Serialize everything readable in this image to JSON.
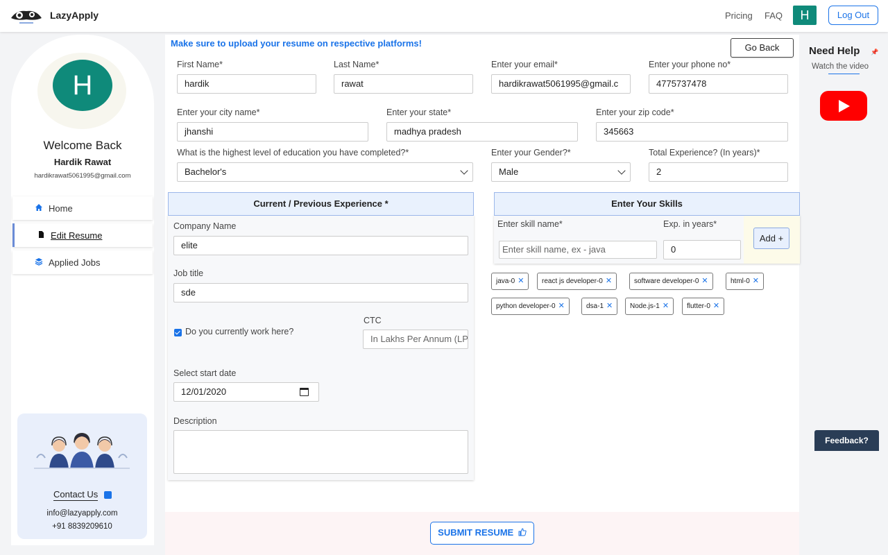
{
  "nav": {
    "brand": "LazyApply",
    "pricing": "Pricing",
    "faq": "FAQ",
    "avatar_initial": "H",
    "logout": "Log Out"
  },
  "sidebar": {
    "avatar_initial": "H",
    "welcome": "Welcome Back",
    "name": "Hardik Rawat",
    "email": "hardikrawat5061995@gmail.com",
    "items": [
      {
        "label": "Home",
        "icon": "home-icon"
      },
      {
        "label": "Edit Resume",
        "icon": "file-icon",
        "active": true
      },
      {
        "label": "Applied Jobs",
        "icon": "layers-icon"
      }
    ],
    "contact": {
      "title": "Contact Us",
      "email": "info@lazyapply.com",
      "phone": "+91 8839209610"
    }
  },
  "form": {
    "notice": "Make sure to upload your resume on respective platforms!",
    "go_back": "Go Back",
    "first_name": {
      "label": "First Name*",
      "value": "hardik"
    },
    "last_name": {
      "label": "Last Name*",
      "value": "rawat"
    },
    "email": {
      "label": "Enter your email*",
      "value": "hardikrawat5061995@gmail.c"
    },
    "phone": {
      "label": "Enter your phone no*",
      "value": "4775737478"
    },
    "city": {
      "label": "Enter your city name*",
      "value": "jhanshi"
    },
    "state": {
      "label": "Enter your state*",
      "value": "madhya pradesh"
    },
    "zip": {
      "label": "Enter your zip code*",
      "value": "345663"
    },
    "education": {
      "label": "What is the highest level of education you have completed?*",
      "value": "Bachelor's"
    },
    "gender": {
      "label": "Enter your Gender?*",
      "value": "Male"
    },
    "experience": {
      "label": "Total Experience? (In years)*",
      "value": "2"
    }
  },
  "experience_section": {
    "title": "Current / Previous Experience *",
    "company": {
      "label": "Company Name",
      "value": "elite"
    },
    "job_title": {
      "label": "Job title",
      "value": "sde"
    },
    "currently_work": {
      "label": "Do you currently work here?",
      "checked": true
    },
    "ctc": {
      "label": "CTC",
      "placeholder": "In Lakhs Per Annum (LPA)"
    },
    "start_date": {
      "label": "Select start date",
      "value": "12/01/2020"
    },
    "description": {
      "label": "Description",
      "value": ""
    }
  },
  "skills_section": {
    "title": "Enter Your Skills",
    "skill_label": "Enter skill name*",
    "skill_placeholder": "Enter skill name, ex - java",
    "years_label": "Exp. in years*",
    "years_value": "0",
    "add_button": "Add +",
    "skills": [
      "java-0",
      "react js developer-0",
      "software developer-0",
      "html-0",
      "python developer-0",
      "dsa-1",
      "Node.js-1",
      "flutter-0"
    ]
  },
  "submit": "SUBMIT RESUME",
  "help": {
    "title": "Need Help",
    "subtitle": "Watch the video"
  },
  "feedback": "Feedback?",
  "colors": {
    "accent": "#1a73e8",
    "avatar": "#0f8a7a",
    "youtube": "#ff0000",
    "feedback_bg": "#2a3d56"
  }
}
